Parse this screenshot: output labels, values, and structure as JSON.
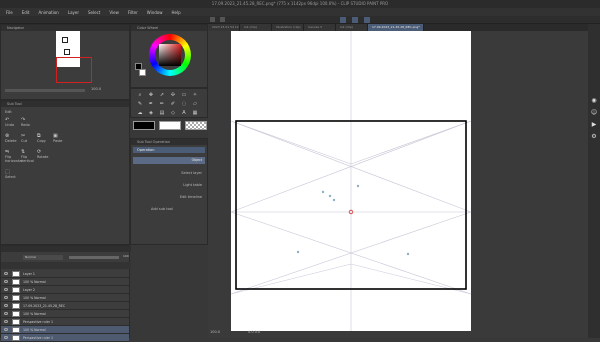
{
  "app": {
    "title": "17.09.2023_21.45.28_REC.png* (775 x 1142px 96dpi 100.0%) - CLIP STUDIO PAINT PRO"
  },
  "menu": [
    "File",
    "Edit",
    "Animation",
    "Layer",
    "Select",
    "View",
    "Filter",
    "Window",
    "Help"
  ],
  "navigator": {
    "title": "Navigator",
    "zoom": "100.0"
  },
  "color_wheel": {
    "title": "Color Wheel",
    "hue": "#e02020"
  },
  "sub_tool": {
    "title": "Sub Tool",
    "group": "Edit",
    "items": [
      "Undo",
      "Redo",
      "Delete",
      "Cut",
      "Copy",
      "Paste",
      "Flip horizontal",
      "Flip vertical",
      "Rotate",
      "Select"
    ]
  },
  "tool_property": {
    "title": "Sub Tool Operation",
    "header": "Operation",
    "rows": [
      "Object",
      "Select layer",
      "Light table",
      "Edit timeline"
    ],
    "add_button": "Add sub tool"
  },
  "layers": {
    "blend": "Normal",
    "opacity": "100",
    "items": [
      {
        "name": "Layer 1"
      },
      {
        "name": "100 % Normal"
      },
      {
        "name": "Layer 2"
      },
      {
        "name": "100 % Normal"
      },
      {
        "name": "17.09.2023_21.45.28_REC"
      },
      {
        "name": "100 % Normal"
      },
      {
        "name": "Perspective ruler 1"
      },
      {
        "name": "100 % Normal"
      },
      {
        "name": "Perspective ruler 1",
        "selected": true
      }
    ]
  },
  "canvas_tabs": [
    "2023 23 01 54 12",
    "Ink (clip)",
    "Illustration (clip)",
    "Canvas 3",
    "Ink (clip)",
    "17.09.2023_21.45.28_REC.png*"
  ],
  "status": {
    "zoom": "100.0",
    "coords": "0.0 0.0"
  },
  "colors": {
    "accent": "#4b5c76",
    "canvas": "#ffffff",
    "bg": "#383838",
    "vanishing": "#d03030"
  }
}
